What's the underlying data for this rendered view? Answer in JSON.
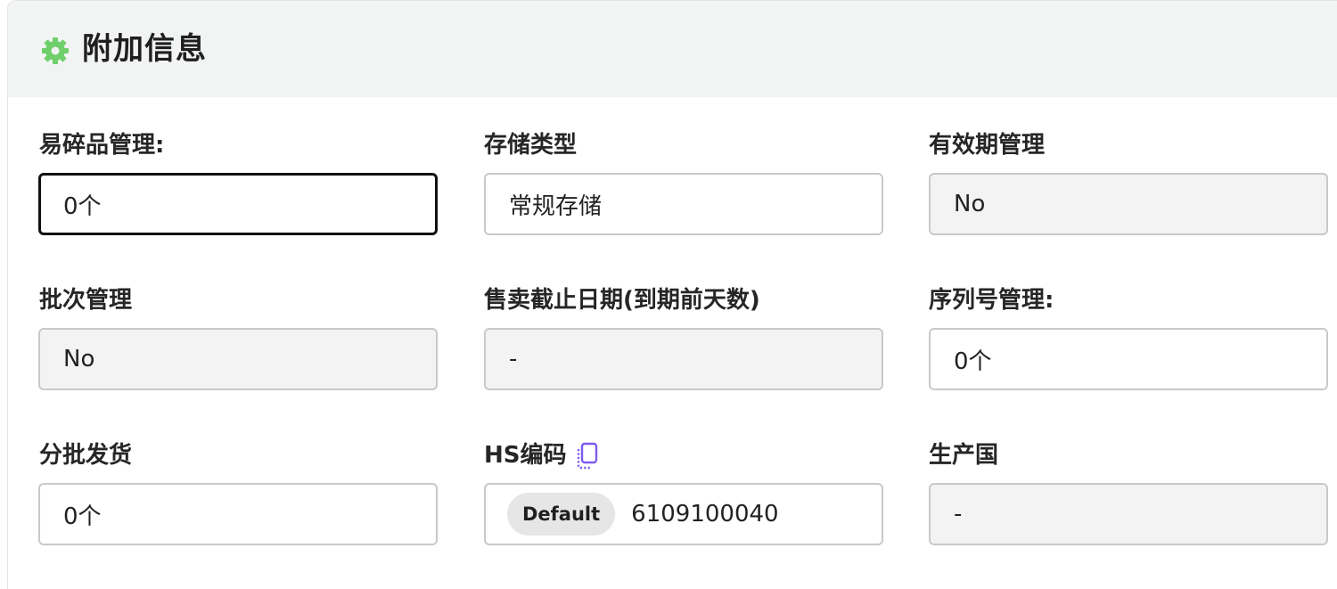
{
  "section": {
    "title": "附加信息",
    "icon": "gear-icon",
    "icon_color": "#6fcf6a"
  },
  "fields": {
    "fragile": {
      "label": "易碎品管理:",
      "value": "0个"
    },
    "storage_type": {
      "label": "存储类型",
      "value": "常规存储"
    },
    "expiry_mgmt": {
      "label": "有效期管理",
      "value": "No"
    },
    "batch_mgmt": {
      "label": "批次管理",
      "value": "No"
    },
    "sell_cutoff": {
      "label": "售卖截止日期(到期前天数)",
      "value": "-"
    },
    "serial_mgmt": {
      "label": "序列号管理:",
      "value": "0个"
    },
    "split_ship": {
      "label": "分批发货",
      "value": "0个"
    },
    "hs_code": {
      "label": "HS编码",
      "badge": "Default",
      "value": "6109100040",
      "copy_icon": "copy-icon"
    },
    "origin_country": {
      "label": "生产国",
      "value": "-"
    }
  }
}
